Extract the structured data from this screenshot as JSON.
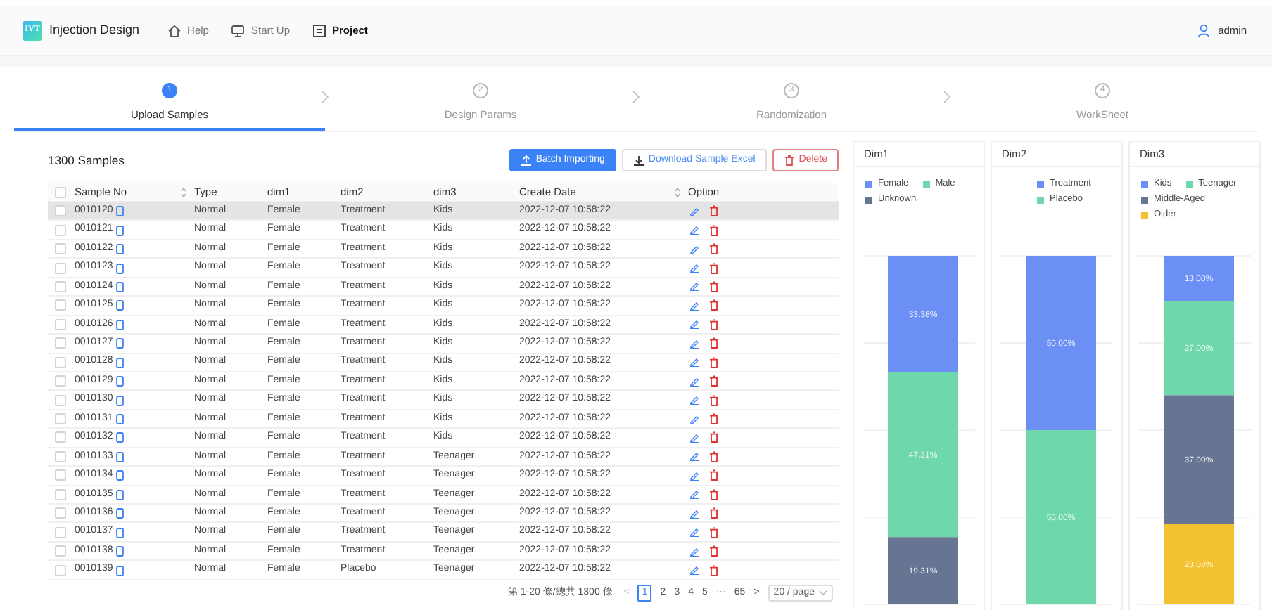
{
  "header": {
    "logo": "IVT",
    "title": "Injection Design",
    "nav": [
      {
        "label": "Help",
        "selected": false
      },
      {
        "label": "Start Up",
        "selected": false
      },
      {
        "label": "Project",
        "selected": true
      }
    ],
    "user": "admin"
  },
  "steps": [
    {
      "number": "1",
      "label": "Upload Samples",
      "selected": true
    },
    {
      "number": "2",
      "label": "Design Params",
      "selected": false
    },
    {
      "number": "3",
      "label": "Randomization",
      "selected": false
    },
    {
      "number": "4",
      "label": "WorkSheet",
      "selected": false
    }
  ],
  "table_panel": {
    "title": "1300 Samples",
    "buttons": [
      {
        "label": "Batch Importing",
        "kind": "primary"
      },
      {
        "label": "Download Sample Excel",
        "kind": "default"
      },
      {
        "label": "Delete",
        "kind": "danger"
      }
    ],
    "select_all_checked": false,
    "columns": [
      {
        "label": "Sample No",
        "sortable": true
      },
      {
        "label": "Type",
        "sortable": false
      },
      {
        "label": "dim1",
        "sortable": false
      },
      {
        "label": "dim2",
        "sortable": false
      },
      {
        "label": "dim3",
        "sortable": false
      },
      {
        "label": "Create Date",
        "sortable": true
      },
      {
        "label": "Option",
        "sortable": false
      }
    ],
    "rows": [
      {
        "sample_no": "0010120",
        "type": "Normal",
        "dim1": "Female",
        "dim2": "Treatment",
        "dim3": "Kids",
        "create_date": "2022-12-07 10:58:22",
        "checked": false,
        "selected": true
      },
      {
        "sample_no": "0010121",
        "type": "Normal",
        "dim1": "Female",
        "dim2": "Treatment",
        "dim3": "Kids",
        "create_date": "2022-12-07 10:58:22",
        "checked": false,
        "selected": false
      },
      {
        "sample_no": "0010122",
        "type": "Normal",
        "dim1": "Female",
        "dim2": "Treatment",
        "dim3": "Kids",
        "create_date": "2022-12-07 10:58:22",
        "checked": false,
        "selected": false
      },
      {
        "sample_no": "0010123",
        "type": "Normal",
        "dim1": "Female",
        "dim2": "Treatment",
        "dim3": "Kids",
        "create_date": "2022-12-07 10:58:22",
        "checked": false,
        "selected": false
      },
      {
        "sample_no": "0010124",
        "type": "Normal",
        "dim1": "Female",
        "dim2": "Treatment",
        "dim3": "Kids",
        "create_date": "2022-12-07 10:58:22",
        "checked": false,
        "selected": false
      },
      {
        "sample_no": "0010125",
        "type": "Normal",
        "dim1": "Female",
        "dim2": "Treatment",
        "dim3": "Kids",
        "create_date": "2022-12-07 10:58:22",
        "checked": false,
        "selected": false
      },
      {
        "sample_no": "0010126",
        "type": "Normal",
        "dim1": "Female",
        "dim2": "Treatment",
        "dim3": "Kids",
        "create_date": "2022-12-07 10:58:22",
        "checked": false,
        "selected": false
      },
      {
        "sample_no": "0010127",
        "type": "Normal",
        "dim1": "Female",
        "dim2": "Treatment",
        "dim3": "Kids",
        "create_date": "2022-12-07 10:58:22",
        "checked": false,
        "selected": false
      },
      {
        "sample_no": "0010128",
        "type": "Normal",
        "dim1": "Female",
        "dim2": "Treatment",
        "dim3": "Kids",
        "create_date": "2022-12-07 10:58:22",
        "checked": false,
        "selected": false
      },
      {
        "sample_no": "0010129",
        "type": "Normal",
        "dim1": "Female",
        "dim2": "Treatment",
        "dim3": "Kids",
        "create_date": "2022-12-07 10:58:22",
        "checked": false,
        "selected": false
      },
      {
        "sample_no": "0010130",
        "type": "Normal",
        "dim1": "Female",
        "dim2": "Treatment",
        "dim3": "Kids",
        "create_date": "2022-12-07 10:58:22",
        "checked": false,
        "selected": false
      },
      {
        "sample_no": "0010131",
        "type": "Normal",
        "dim1": "Female",
        "dim2": "Treatment",
        "dim3": "Kids",
        "create_date": "2022-12-07 10:58:22",
        "checked": false,
        "selected": false
      },
      {
        "sample_no": "0010132",
        "type": "Normal",
        "dim1": "Female",
        "dim2": "Treatment",
        "dim3": "Kids",
        "create_date": "2022-12-07 10:58:22",
        "checked": false,
        "selected": false
      },
      {
        "sample_no": "0010133",
        "type": "Normal",
        "dim1": "Female",
        "dim2": "Treatment",
        "dim3": "Teenager",
        "create_date": "2022-12-07 10:58:22",
        "checked": false,
        "selected": false
      },
      {
        "sample_no": "0010134",
        "type": "Normal",
        "dim1": "Female",
        "dim2": "Treatment",
        "dim3": "Teenager",
        "create_date": "2022-12-07 10:58:22",
        "checked": false,
        "selected": false
      },
      {
        "sample_no": "0010135",
        "type": "Normal",
        "dim1": "Female",
        "dim2": "Treatment",
        "dim3": "Teenager",
        "create_date": "2022-12-07 10:58:22",
        "checked": false,
        "selected": false
      },
      {
        "sample_no": "0010136",
        "type": "Normal",
        "dim1": "Female",
        "dim2": "Treatment",
        "dim3": "Teenager",
        "create_date": "2022-12-07 10:58:22",
        "checked": false,
        "selected": false
      },
      {
        "sample_no": "0010137",
        "type": "Normal",
        "dim1": "Female",
        "dim2": "Treatment",
        "dim3": "Teenager",
        "create_date": "2022-12-07 10:58:22",
        "checked": false,
        "selected": false
      },
      {
        "sample_no": "0010138",
        "type": "Normal",
        "dim1": "Female",
        "dim2": "Treatment",
        "dim3": "Teenager",
        "create_date": "2022-12-07 10:58:22",
        "checked": false,
        "selected": false
      },
      {
        "sample_no": "0010139",
        "type": "Normal",
        "dim1": "Female",
        "dim2": "Placebo",
        "dim3": "Teenager",
        "create_date": "2022-12-07 10:58:22",
        "checked": false,
        "selected": false
      }
    ],
    "pagination": {
      "summary": "第 1-20 條/總共 1300 條",
      "prev": "<",
      "pages": [
        {
          "label": "1",
          "selected": true
        },
        {
          "label": "2",
          "selected": false
        },
        {
          "label": "3",
          "selected": false
        },
        {
          "label": "4",
          "selected": false
        },
        {
          "label": "5",
          "selected": false
        },
        {
          "label": "···",
          "selected": false
        },
        {
          "label": "65",
          "selected": false
        }
      ],
      "next": ">",
      "page_size": "20 / page"
    }
  },
  "charts": [
    {
      "title": "Dim1",
      "segments": [
        {
          "name": "Female",
          "color": "#6b8ff5",
          "label": "33.38%"
        },
        {
          "name": "Male",
          "color": "#6fd8aa",
          "label": "47.31%"
        },
        {
          "name": "Unknown",
          "color": "#677592",
          "label": "19.31%"
        }
      ]
    },
    {
      "title": "Dim2",
      "segments": [
        {
          "name": "Treatment",
          "color": "#6b8ff5",
          "label": "50.00%"
        },
        {
          "name": "Placebo",
          "color": "#6fd8aa",
          "label": "50.00%"
        }
      ]
    },
    {
      "title": "Dim3",
      "segments": [
        {
          "name": "Kids",
          "color": "#6b8ff5",
          "label": "13.00%"
        },
        {
          "name": "Teenager",
          "color": "#6fd8aa",
          "label": "27.00%"
        },
        {
          "name": "Middle-Aged",
          "color": "#677592",
          "label": "37.00%"
        },
        {
          "name": "Older",
          "color": "#f2c230",
          "label": "23.00%"
        }
      ]
    }
  ]
}
